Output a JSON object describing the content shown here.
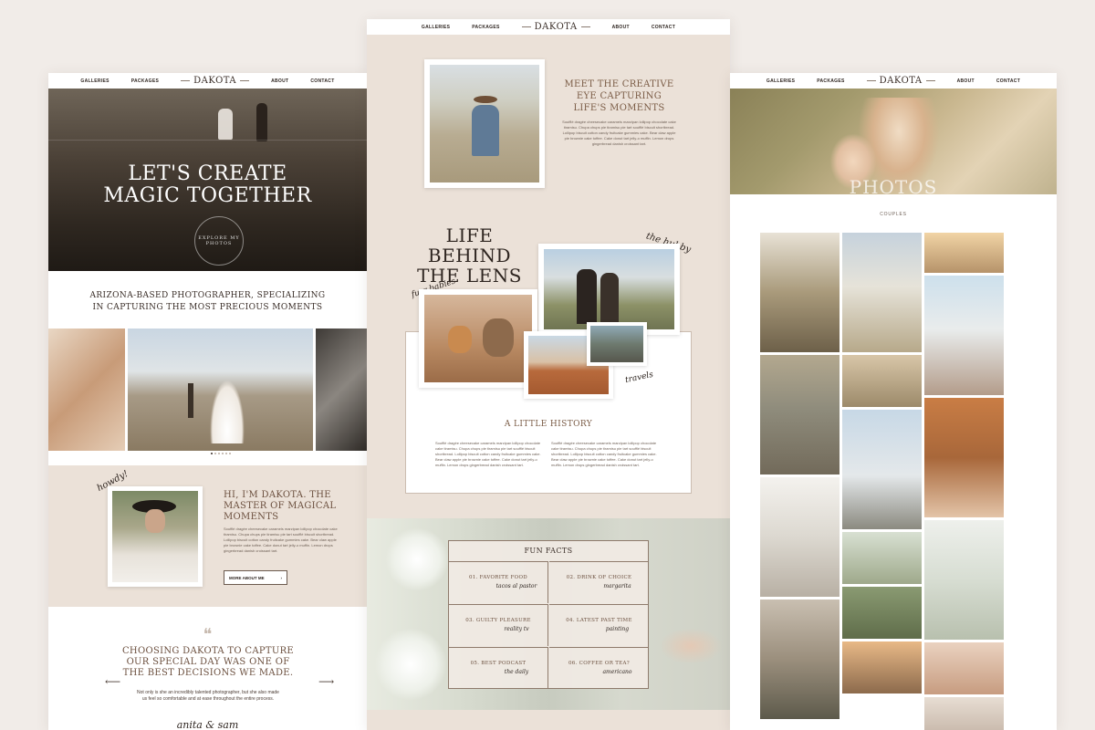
{
  "nav": {
    "items": [
      "GALLERIES",
      "PACKAGES",
      "ABOUT",
      "CONTACT"
    ],
    "logo": "DAKOTA"
  },
  "left": {
    "hero_title_line1": "LET'S CREATE",
    "hero_title_line2": "MAGIC TOGETHER",
    "badge": "EXPLORE MY PHOTOS",
    "tagline_line1": "ARIZONA-BASED PHOTOGRAPHER, SPECIALIZING",
    "tagline_line2": "IN CAPTURING THE MOST PRECIOUS MOMENTS",
    "howdy": "howdy!",
    "about_title": "HI, I'M DAKOTA. THE MASTER OF MAGICAL MOMENTS",
    "about_body": "Soufflé dragée cheesecake caramels marzipan lollipop chocolate cake tiramisu. Chupa chups pie tiramisu pie tart soufflé biscuit shortbread. Lollipop biscuit cotton candy fruitcake gummies cake. Bear claw apple pie brownie cake toffee. Cake donut tart jelly-o muffin. Lemon drops gingerbread danish croissant tart.",
    "about_button": "MORE ABOUT ME",
    "quote_mark": "❝",
    "testimonial": "CHOOSING DAKOTA TO CAPTURE OUR SPECIAL DAY WAS ONE OF THE BEST DECISIONS WE MADE.",
    "testimonial_body": "Not only is she an incredibly talented photographer, but she also made us feel so comfortable and at ease throughout the entire process.",
    "signature": "anita & sam",
    "prev_arrow": "⟵",
    "next_arrow": "⟶"
  },
  "center": {
    "meet_title": "MEET THE CREATIVE EYE CAPTURING LIFE'S MOMENTS",
    "meet_body": "Soufflé dragée cheesecake caramels marzipan lollipop chocolate cake tiramisu. Chupa chups pie tiramisu pie tart soufflé biscuit shortbread. Lollipop biscuit cotton candy fruitcake gummies cake. Bear claw apple pie brownie cake toffee. Cake donut tart jelly-o muffin. Lemon drops gingerbread danish croissant tart.",
    "life_title_line1": "LIFE BEHIND",
    "life_title_line2": "THE LENS",
    "hubby": "the hubby",
    "furr": "furr babies",
    "travels": "travels",
    "history_title": "A LITTLE HISTORY",
    "history_col1": "Soufflé dragée cheesecake caramels marzipan lollipop chocolate cake tiramisu. Chupa chups pie tiramisu pie tart soufflé biscuit shortbread. Lollipop biscuit cotton candy fruitcake gummies cake. Bear claw apple pie brownie cake toffee. Cake donut tart jelly-o muffin. Lemon drops gingerbread danish croissant tart.",
    "history_col2": "Soufflé dragée cheesecake caramels marzipan lollipop chocolate cake tiramisu. Chupa chups pie tiramisu pie tart soufflé biscuit shortbread. Lollipop biscuit cotton candy fruitcake gummies cake. Bear claw apple pie brownie cake toffee. Cake donut tart jelly-o muffin. Lemon drops gingerbread danish croissant tart.",
    "facts_title": "FUN FACTS",
    "facts": [
      {
        "q": "01. FAVORITE FOOD",
        "a": "tacos al pastor"
      },
      {
        "q": "02. DRINK OF CHOICE",
        "a": "margarita"
      },
      {
        "q": "03. GUILTY PLEASURE",
        "a": "reality tv"
      },
      {
        "q": "04. LATEST PAST TIME",
        "a": "painting"
      },
      {
        "q": "05. BEST PODCAST",
        "a": "the daily"
      },
      {
        "q": "06. COFFEE OR TEA?",
        "a": "americano"
      }
    ]
  },
  "right": {
    "hero_title": "PHOTOS",
    "category": "COUPLES"
  },
  "colors": {
    "background": "#f1ece8",
    "beige_band": "#ebe1d8",
    "accent_brown": "#7a5b45",
    "text_dark": "#2e2520"
  }
}
